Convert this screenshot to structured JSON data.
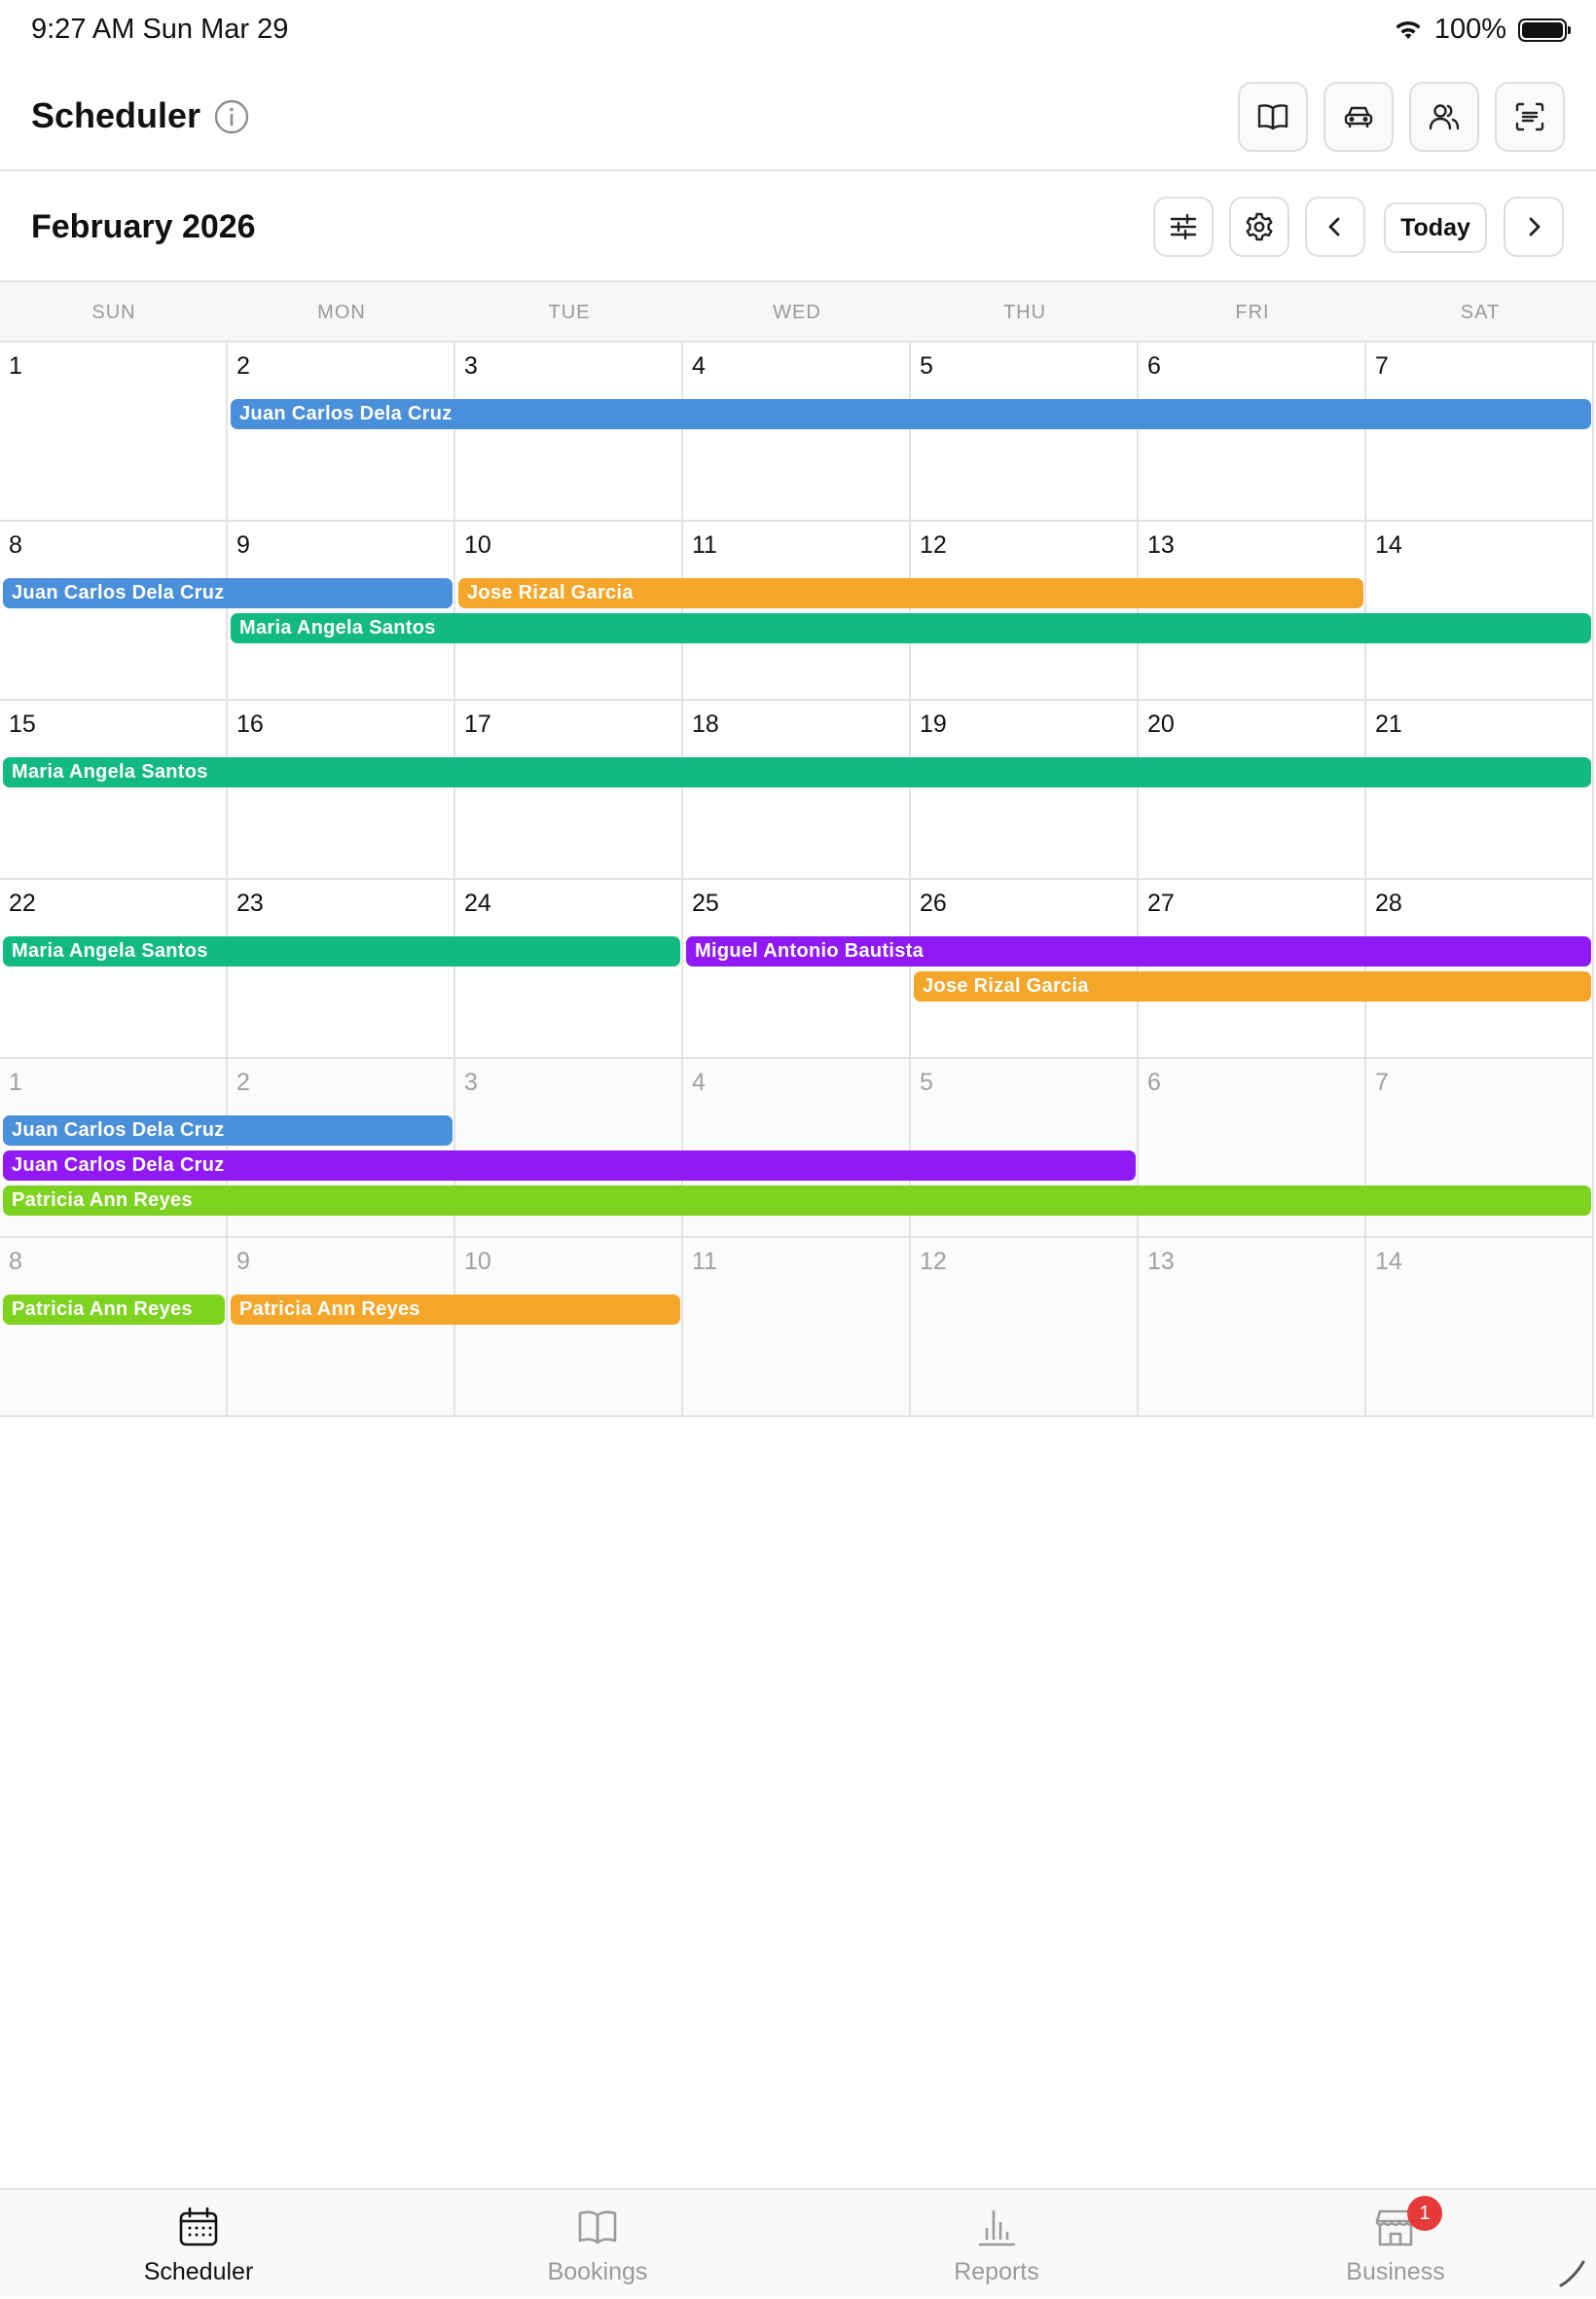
{
  "status_bar": {
    "time": "9:27 AM   Sun Mar 29",
    "battery": "100%"
  },
  "header": {
    "title": "Scheduler",
    "icons": [
      "book-icon",
      "car-icon",
      "users-icon",
      "scan-icon"
    ]
  },
  "calendar": {
    "month_title": "February 2026",
    "today_label": "Today",
    "weekdays": [
      "SUN",
      "MON",
      "TUE",
      "WED",
      "THU",
      "FRI",
      "SAT"
    ],
    "weeks": [
      [
        {
          "d": "1",
          "o": false
        },
        {
          "d": "2",
          "o": false
        },
        {
          "d": "3",
          "o": false
        },
        {
          "d": "4",
          "o": false
        },
        {
          "d": "5",
          "o": false
        },
        {
          "d": "6",
          "o": false
        },
        {
          "d": "7",
          "o": false
        }
      ],
      [
        {
          "d": "8",
          "o": false
        },
        {
          "d": "9",
          "o": false
        },
        {
          "d": "10",
          "o": false
        },
        {
          "d": "11",
          "o": false
        },
        {
          "d": "12",
          "o": false
        },
        {
          "d": "13",
          "o": false
        },
        {
          "d": "14",
          "o": false
        }
      ],
      [
        {
          "d": "15",
          "o": false
        },
        {
          "d": "16",
          "o": false
        },
        {
          "d": "17",
          "o": false
        },
        {
          "d": "18",
          "o": false
        },
        {
          "d": "19",
          "o": false
        },
        {
          "d": "20",
          "o": false
        },
        {
          "d": "21",
          "o": false
        }
      ],
      [
        {
          "d": "22",
          "o": false
        },
        {
          "d": "23",
          "o": false
        },
        {
          "d": "24",
          "o": false
        },
        {
          "d": "25",
          "o": false
        },
        {
          "d": "26",
          "o": false
        },
        {
          "d": "27",
          "o": false
        },
        {
          "d": "28",
          "o": false
        }
      ],
      [
        {
          "d": "1",
          "o": true
        },
        {
          "d": "2",
          "o": true
        },
        {
          "d": "3",
          "o": true
        },
        {
          "d": "4",
          "o": true
        },
        {
          "d": "5",
          "o": true
        },
        {
          "d": "6",
          "o": true
        },
        {
          "d": "7",
          "o": true
        }
      ],
      [
        {
          "d": "8",
          "o": true
        },
        {
          "d": "9",
          "o": true
        },
        {
          "d": "10",
          "o": true
        },
        {
          "d": "11",
          "o": true
        },
        {
          "d": "12",
          "o": true
        },
        {
          "d": "13",
          "o": true
        },
        {
          "d": "14",
          "o": true
        }
      ]
    ],
    "events": [
      {
        "label": "Juan Carlos Dela Cruz",
        "color": "#4a8fd9",
        "week": 0,
        "start": 1,
        "end": 6,
        "lane": 0
      },
      {
        "label": "Juan Carlos Dela Cruz",
        "color": "#4a8fd9",
        "week": 1,
        "start": 0,
        "end": 1,
        "lane": 0
      },
      {
        "label": "Jose Rizal Garcia",
        "color": "#f4a62a",
        "week": 1,
        "start": 2,
        "end": 5,
        "lane": 0
      },
      {
        "label": "Maria Angela Santos",
        "color": "#12b981",
        "week": 1,
        "start": 1,
        "end": 6,
        "lane": 1
      },
      {
        "label": "Maria Angela Santos",
        "color": "#12b981",
        "week": 2,
        "start": 0,
        "end": 6,
        "lane": 0
      },
      {
        "label": "Maria Angela Santos",
        "color": "#12b981",
        "week": 3,
        "start": 0,
        "end": 2,
        "lane": 0
      },
      {
        "label": "Miguel Antonio Bautista",
        "color": "#9119f5",
        "week": 3,
        "start": 3,
        "end": 6,
        "lane": 0
      },
      {
        "label": "Jose Rizal Garcia",
        "color": "#f4a62a",
        "week": 3,
        "start": 4,
        "end": 6,
        "lane": 1
      },
      {
        "label": "Juan Carlos Dela Cruz",
        "color": "#4a8fd9",
        "week": 4,
        "start": 0,
        "end": 1,
        "lane": 0
      },
      {
        "label": "Juan Carlos Dela Cruz",
        "color": "#9119f5",
        "week": 4,
        "start": 0,
        "end": 4,
        "lane": 1
      },
      {
        "label": "Patricia Ann Reyes",
        "color": "#7ed321",
        "week": 4,
        "start": 0,
        "end": 6,
        "lane": 2
      },
      {
        "label": "Patricia Ann Reyes",
        "color": "#7ed321",
        "week": 5,
        "start": 0,
        "end": 0,
        "lane": 0
      },
      {
        "label": "Patricia Ann Reyes",
        "color": "#f4a62a",
        "week": 5,
        "start": 1,
        "end": 2,
        "lane": 0
      }
    ]
  },
  "tab_bar": {
    "tabs": [
      {
        "label": "Scheduler",
        "icon": "calendar-icon",
        "active": true
      },
      {
        "label": "Bookings",
        "icon": "book-icon",
        "active": false
      },
      {
        "label": "Reports",
        "icon": "chart-icon",
        "active": false
      },
      {
        "label": "Business",
        "icon": "store-icon",
        "active": false,
        "badge": "1"
      }
    ]
  }
}
